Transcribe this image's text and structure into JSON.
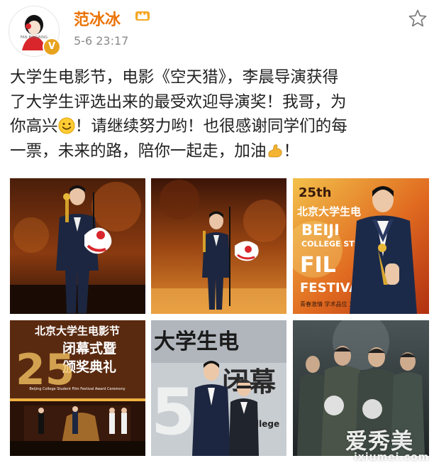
{
  "post": {
    "author": "范冰冰",
    "time": "5-6 23:17",
    "avatar_caption": "FAN BINGBING",
    "text_lines": [
      "大学生电影节，电影《空天猎》，李晨导演获得",
      "了大学生评选出来的最受欢迎导演奖！我哥，为",
      "你高兴",
      "！请继续努力哟！也很感谢同学们的每",
      "一票，未来的路，陪你一起走，加油",
      "！"
    ],
    "icons": {
      "avatar": "avatar-icon",
      "verified": "verified-badge-icon",
      "crown": "crown-icon",
      "favorite": "star-outline-icon",
      "emoji_smile": "smile-emoji-icon",
      "emoji_strong": "flexed-biceps-emoji-icon"
    },
    "colors": {
      "author": "#eb7305",
      "time": "#8a8a8a",
      "verified": "#e8a31e"
    }
  },
  "photos": {
    "photo_3": {
      "line1": "25th",
      "line2": "北京大学生电",
      "line3": "BEIJI",
      "line4": "COLLEGE STU",
      "line5": "FIL",
      "line6": "FESTIVA",
      "line7": "青春激情 学术品位 文化"
    },
    "photo_4": {
      "line1": "北京大学生电影节",
      "line2": "闭幕式暨",
      "line3": "颁奖典礼",
      "line4": "25",
      "line5": "Beijing College Student Film Festival Award Ceremony"
    },
    "photo_5": {
      "line1": "大学生电",
      "line2": "闭幕",
      "line3": "5",
      "line4": "llege"
    }
  },
  "watermark": {
    "main": "爱秀美",
    "sub": "ixiumei.com"
  }
}
